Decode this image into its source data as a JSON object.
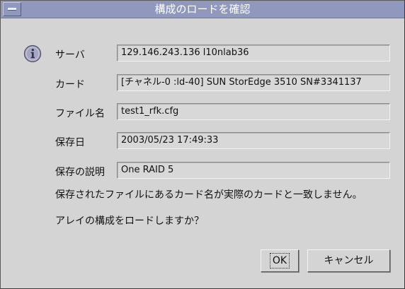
{
  "window": {
    "title": "構成のロードを確認"
  },
  "fields": [
    {
      "label": "サーバ",
      "value": "129.146.243.136 l10nlab36"
    },
    {
      "label": "カード",
      "value": "[チャネル-0 :ld-40] SUN StorEdge 3510 SN#3341137"
    },
    {
      "label": "ファイル名",
      "value": "test1_rfk.cfg"
    },
    {
      "label": "保存日",
      "value": "2003/05/23 17:49:33"
    },
    {
      "label": "保存の説明",
      "value": "One RAID 5"
    }
  ],
  "messages": {
    "warning": "保存されたファイルにあるカード名が実際のカードと一致しません。",
    "question": "アレイの構成をロードしますか？"
  },
  "buttons": {
    "ok": "OK",
    "cancel": "キャンセル"
  },
  "icon": "info-icon",
  "colors": {
    "titlebar": "#9099bd",
    "background": "#d4d4d4"
  }
}
